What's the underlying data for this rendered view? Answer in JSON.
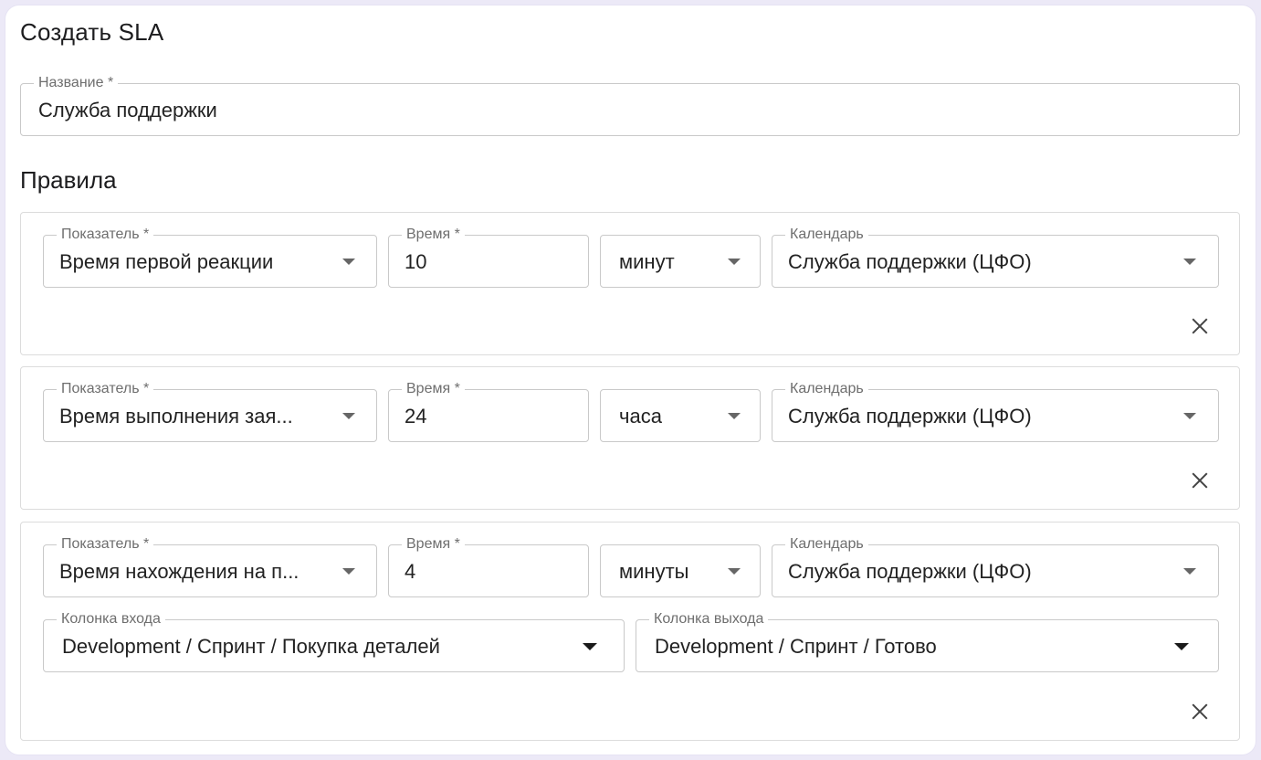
{
  "form": {
    "title": "Создать SLA",
    "name_field": {
      "label": "Название *",
      "value": "Служба поддержки"
    },
    "rules_title": "Правила"
  },
  "rules": [
    {
      "indicator": {
        "label": "Показатель *",
        "value": "Время первой реакции"
      },
      "time": {
        "label": "Время *",
        "value": "10"
      },
      "unit": {
        "value": "минут"
      },
      "calendar": {
        "label": "Календарь",
        "value": "Служба поддержки (ЦФО)"
      }
    },
    {
      "indicator": {
        "label": "Показатель *",
        "value": "Время выполнения зая..."
      },
      "time": {
        "label": "Время *",
        "value": "24"
      },
      "unit": {
        "value": "часа"
      },
      "calendar": {
        "label": "Календарь",
        "value": "Служба поддержки (ЦФО)"
      }
    },
    {
      "indicator": {
        "label": "Показатель *",
        "value": "Время нахождения на п..."
      },
      "time": {
        "label": "Время *",
        "value": "4"
      },
      "unit": {
        "value": "минуты"
      },
      "calendar": {
        "label": "Календарь",
        "value": "Служба поддержки (ЦФО)"
      },
      "entry_column": {
        "label": "Колонка входа",
        "value": "Development / Спринт / Покупка деталей"
      },
      "exit_column": {
        "label": "Колонка выхода",
        "value": "Development / Спринт / Готово"
      }
    }
  ],
  "icons": {
    "dropdown": "caret-down-icon",
    "remove": "close-icon"
  },
  "colors": {
    "background": "#ece9f7",
    "border": "#c9c9c9",
    "label": "#6e6e6e"
  }
}
